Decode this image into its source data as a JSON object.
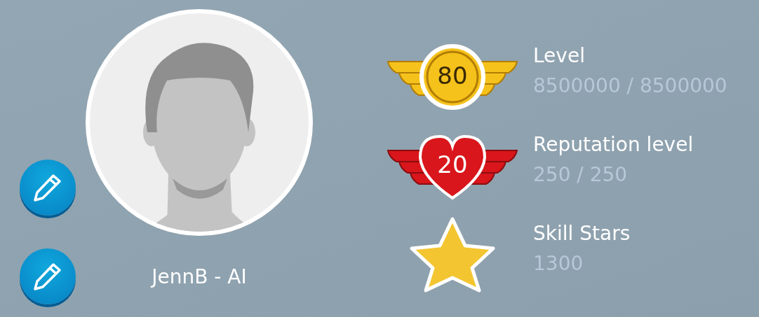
{
  "profile": {
    "name": "JennB - AI"
  },
  "edit_buttons": [
    {
      "kind": "edit"
    },
    {
      "kind": "edit"
    }
  ],
  "stats": [
    {
      "kind": "wings",
      "color": "#f5c21b",
      "badge": "80",
      "label": "Level",
      "value": "8500000 / 8500000"
    },
    {
      "kind": "heart",
      "color": "#d8161b",
      "badge": "20",
      "label": "Reputation level",
      "value": "250 / 250"
    },
    {
      "kind": "star",
      "color": "#f3c530",
      "label": "Skill Stars",
      "value": "1300"
    }
  ]
}
